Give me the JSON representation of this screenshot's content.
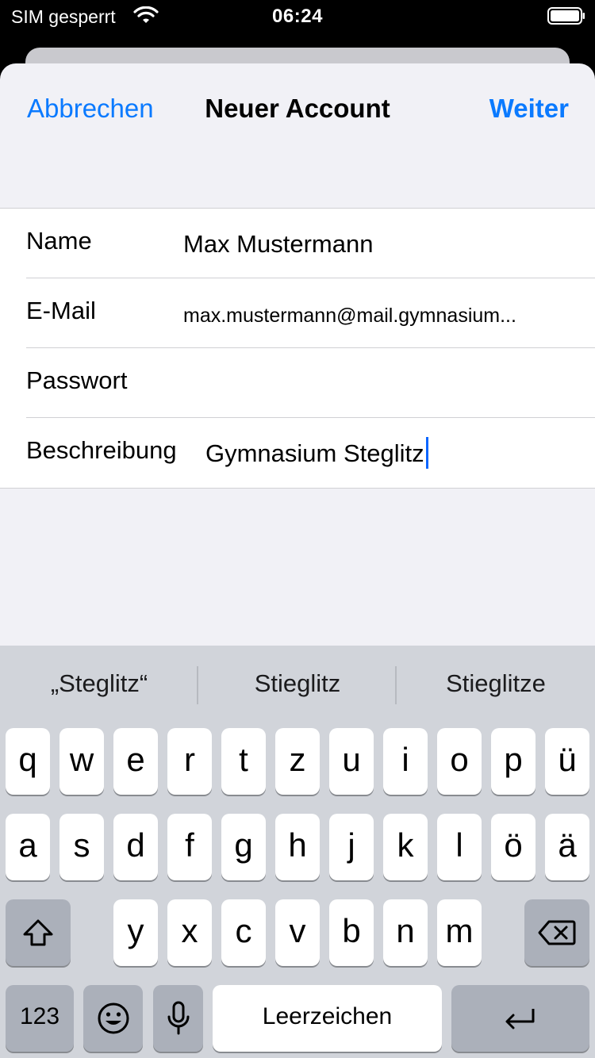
{
  "status_bar": {
    "carrier": "SIM gesperrt",
    "time": "06:24"
  },
  "nav": {
    "cancel_label": "Abbrechen",
    "title": "Neuer Account",
    "next_label": "Weiter"
  },
  "form": {
    "rows": [
      {
        "label": "Name",
        "value": "Max Mustermann"
      },
      {
        "label": "E-Mail",
        "value": "max.mustermann@mail.gymnasium..."
      },
      {
        "label": "Passwort",
        "value": ""
      },
      {
        "label": "Beschreibung",
        "value": "Gymnasium Steglitz"
      }
    ]
  },
  "keyboard": {
    "suggestions": [
      "„Steglitz“",
      "Stieglitz",
      "Stieglitze"
    ],
    "row1": [
      "q",
      "w",
      "e",
      "r",
      "t",
      "z",
      "u",
      "i",
      "o",
      "p",
      "ü"
    ],
    "row2": [
      "a",
      "s",
      "d",
      "f",
      "g",
      "h",
      "j",
      "k",
      "l",
      "ö",
      "ä"
    ],
    "row3": [
      "y",
      "x",
      "c",
      "v",
      "b",
      "n",
      "m"
    ],
    "numbers_label": "123",
    "space_label": "Leerzeichen",
    "icons": {
      "shift": "shift-icon",
      "delete": "delete-icon",
      "emoji": "emoji-icon",
      "mic": "microphone-icon",
      "return": "return-icon"
    }
  },
  "colors": {
    "accent": "#0a7aff",
    "caret": "#0a66ff",
    "keyboard_bg": "#d1d4da",
    "sheet_bg": "#f1f1f6"
  }
}
